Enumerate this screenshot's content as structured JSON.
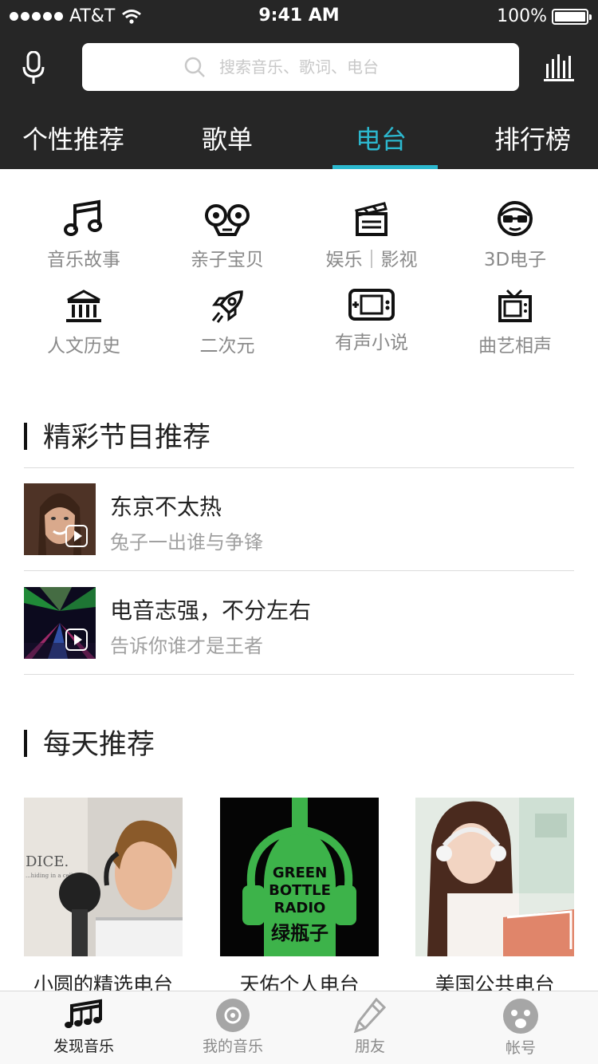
{
  "status_bar": {
    "carrier": "AT&T",
    "time": "9:41 AM",
    "battery": "100%"
  },
  "search": {
    "placeholder": "搜索音乐、歌词、电台"
  },
  "tabs": [
    {
      "label": "个性推荐"
    },
    {
      "label": "歌单"
    },
    {
      "label": "电台",
      "active": true
    },
    {
      "label": "排行榜"
    }
  ],
  "categories": [
    {
      "label": "音乐故事",
      "icon": "music-note-icon"
    },
    {
      "label": "亲子宝贝",
      "icon": "toy-face-icon"
    },
    {
      "label": "娱乐｜影视",
      "icon": "clapperboard-icon"
    },
    {
      "label": "3D电子",
      "icon": "glasses-face-icon"
    },
    {
      "label": "人文历史",
      "icon": "museum-icon"
    },
    {
      "label": "二次元",
      "icon": "rocket-icon"
    },
    {
      "label": "有声小说",
      "icon": "gamepad-icon"
    },
    {
      "label": "曲艺相声",
      "icon": "tv-icon"
    }
  ],
  "featured": {
    "title": "精彩节目推荐",
    "items": [
      {
        "title": "东京不太热",
        "subtitle": "兔子一出谁与争锋"
      },
      {
        "title": "电音志强，不分左右",
        "subtitle": "告诉你谁才是王者"
      }
    ]
  },
  "daily": {
    "title": "每天推荐",
    "cards": [
      {
        "title": "小圆的精选电台",
        "art_text": [
          "DICE.",
          "...hiding in a cello..."
        ]
      },
      {
        "title": "天佑个人电台",
        "art_text": [
          "GREEN",
          "BOTTLE",
          "RADIO",
          "绿瓶子"
        ]
      },
      {
        "title": "美国公共电台"
      }
    ]
  },
  "bottom_nav": [
    {
      "label": "发现音乐",
      "active": true
    },
    {
      "label": "我的音乐"
    },
    {
      "label": "朋友"
    },
    {
      "label": "帐号"
    }
  ],
  "colors": {
    "header": "#262626",
    "accent": "#2cb8cf"
  }
}
